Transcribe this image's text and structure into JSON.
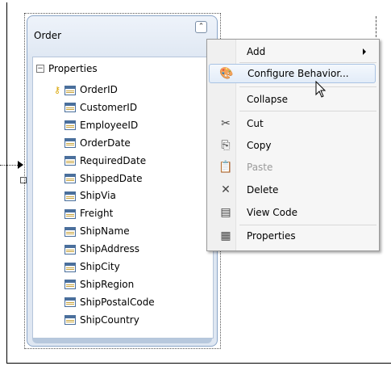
{
  "entity": {
    "title": "Order",
    "section_label": "Properties",
    "properties": [
      {
        "name": "OrderID",
        "is_key": true
      },
      {
        "name": "CustomerID",
        "is_key": false
      },
      {
        "name": "EmployeeID",
        "is_key": false
      },
      {
        "name": "OrderDate",
        "is_key": false
      },
      {
        "name": "RequiredDate",
        "is_key": false
      },
      {
        "name": "ShippedDate",
        "is_key": false
      },
      {
        "name": "ShipVia",
        "is_key": false
      },
      {
        "name": "Freight",
        "is_key": false
      },
      {
        "name": "ShipName",
        "is_key": false
      },
      {
        "name": "ShipAddress",
        "is_key": false
      },
      {
        "name": "ShipCity",
        "is_key": false
      },
      {
        "name": "ShipRegion",
        "is_key": false
      },
      {
        "name": "ShipPostalCode",
        "is_key": false
      },
      {
        "name": "ShipCountry",
        "is_key": false
      }
    ]
  },
  "context_menu": {
    "items": [
      {
        "label": "Add",
        "icon": "none",
        "submenu": true
      },
      {
        "label": "Configure Behavior...",
        "icon": "configure-behavior-icon",
        "hovered": true
      },
      {
        "label": "Collapse",
        "icon": "none"
      },
      {
        "label": "Cut",
        "icon": "scissors-icon"
      },
      {
        "label": "Copy",
        "icon": "copy-icon"
      },
      {
        "label": "Paste",
        "icon": "paste-icon",
        "disabled": true
      },
      {
        "label": "Delete",
        "icon": "delete-icon"
      },
      {
        "label": "View Code",
        "icon": "view-code-icon"
      },
      {
        "label": "Properties",
        "icon": "properties-icon"
      }
    ]
  },
  "colors": {
    "entity_border": "#8aa5c8",
    "menu_hover": "#e2ecf8",
    "key_icon": "#d9a400"
  }
}
